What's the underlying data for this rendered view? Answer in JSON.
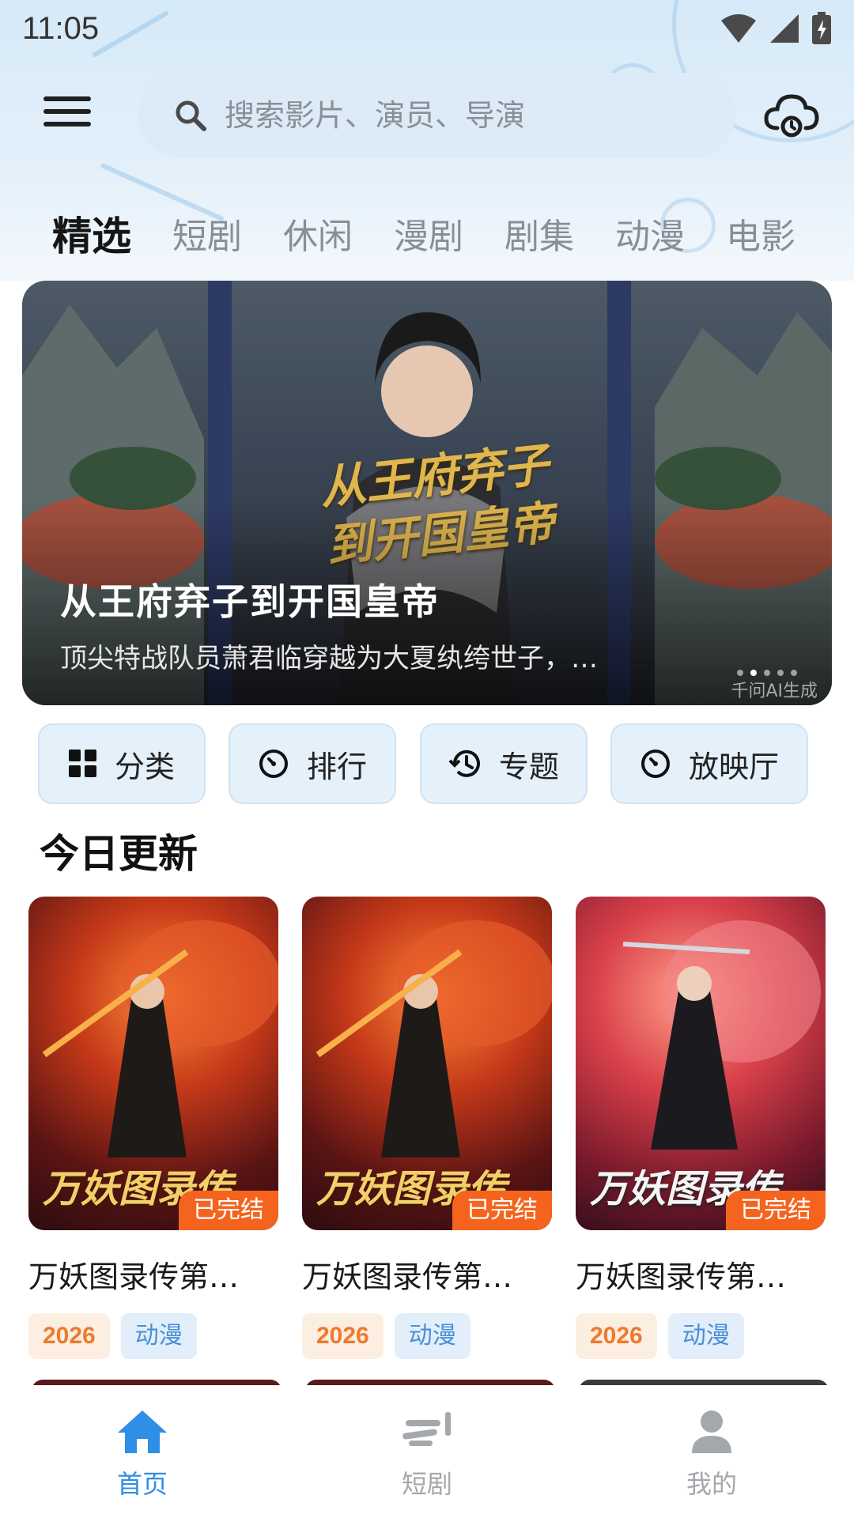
{
  "status_bar": {
    "time": "11:05"
  },
  "search": {
    "placeholder": "搜索影片、演员、导演"
  },
  "tabs": [
    {
      "label": "精选",
      "active": true
    },
    {
      "label": "短剧"
    },
    {
      "label": "休闲"
    },
    {
      "label": "漫剧"
    },
    {
      "label": "剧集"
    },
    {
      "label": "动漫"
    },
    {
      "label": "电影"
    }
  ],
  "banner": {
    "title": "从王府弃子到开国皇帝",
    "description": "顶尖特战队员萧君临穿越为大夏纨绔世子，…",
    "calligraphy": "从王府弃子\n到开国皇帝",
    "ai_mark": "千问AI生成",
    "page_count": 5,
    "active_page": 2
  },
  "quick_links": [
    {
      "label": "分类",
      "icon": "grid-icon"
    },
    {
      "label": "排行",
      "icon": "clock-icon"
    },
    {
      "label": "专题",
      "icon": "history-icon"
    },
    {
      "label": "放映厅",
      "icon": "clock-icon"
    }
  ],
  "section": {
    "title": "今日更新"
  },
  "cards": [
    {
      "poster_text": "万妖图录传",
      "badge": "已完结",
      "title": "万妖图录传第…",
      "year": "2026",
      "genre": "动漫"
    },
    {
      "poster_text": "万妖图录传",
      "badge": "已完结",
      "title": "万妖图录传第…",
      "year": "2026",
      "genre": "动漫"
    },
    {
      "poster_text": "万妖图录传",
      "badge": "已完结",
      "title": "万妖图录传第…",
      "year": "2026",
      "genre": "动漫"
    }
  ],
  "bottom_nav": [
    {
      "label": "首页",
      "icon": "home-icon",
      "active": true
    },
    {
      "label": "短剧",
      "icon": "shorts-icon"
    },
    {
      "label": "我的",
      "icon": "profile-icon"
    }
  ],
  "colors": {
    "accent": "#2f8ee6",
    "badge": "#f4641e",
    "year_tag_text": "#ee7a2c",
    "genre_tag_text": "#4a8fd6",
    "header_bg": "#d6e9f8"
  }
}
